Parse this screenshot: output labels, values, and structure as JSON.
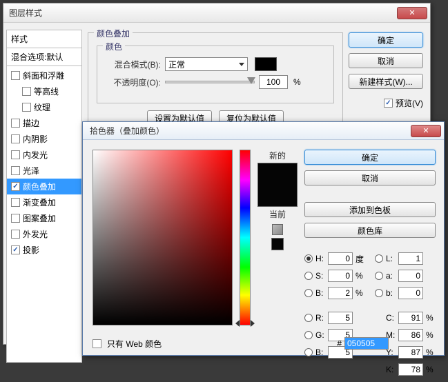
{
  "main": {
    "title": "图层样式",
    "styles_header": "样式",
    "styles_sub": "混合选项:默认",
    "items": [
      {
        "label": "斜面和浮雕",
        "checked": false,
        "indent": false
      },
      {
        "label": "等高线",
        "checked": false,
        "indent": true
      },
      {
        "label": "纹理",
        "checked": false,
        "indent": true
      },
      {
        "label": "描边",
        "checked": false,
        "indent": false
      },
      {
        "label": "内阴影",
        "checked": false,
        "indent": false
      },
      {
        "label": "内发光",
        "checked": false,
        "indent": false
      },
      {
        "label": "光泽",
        "checked": false,
        "indent": false
      },
      {
        "label": "颜色叠加",
        "checked": true,
        "indent": false,
        "selected": true
      },
      {
        "label": "渐变叠加",
        "checked": false,
        "indent": false
      },
      {
        "label": "图案叠加",
        "checked": false,
        "indent": false
      },
      {
        "label": "外发光",
        "checked": false,
        "indent": false
      },
      {
        "label": "投影",
        "checked": true,
        "indent": false
      }
    ],
    "section_title": "颜色叠加",
    "inner_title": "颜色",
    "blend_label": "混合模式(B):",
    "blend_value": "正常",
    "opacity_label": "不透明度(O):",
    "opacity_value": "100",
    "pct": "%",
    "set_default": "设置为默认值",
    "reset_default": "复位为默认值",
    "ok": "确定",
    "cancel": "取消",
    "new_style": "新建样式(W)...",
    "preview": "预览(V)"
  },
  "picker": {
    "title": "拾色器（叠加颜色）",
    "ok": "确定",
    "cancel": "取消",
    "add_swatch": "添加到色板",
    "libraries": "颜色库",
    "new": "新的",
    "current": "当前",
    "web_only": "只有 Web 颜色",
    "hash": "#",
    "hex": "050505",
    "H_label": "H:",
    "H_val": "0",
    "H_unit": "度",
    "S_label": "S:",
    "S_val": "0",
    "S_unit": "%",
    "Bhsb_label": "B:",
    "Bhsb_val": "2",
    "Bhsb_unit": "%",
    "L_label": "L:",
    "L_val": "1",
    "a_label": "a:",
    "a_val": "0",
    "blab_label": "b:",
    "blab_val": "0",
    "R_label": "R:",
    "R_val": "5",
    "G_label": "G:",
    "G_val": "5",
    "Brgb_label": "B:",
    "Brgb_val": "5",
    "C_label": "C:",
    "C_val": "91",
    "C_unit": "%",
    "M_label": "M:",
    "M_val": "86",
    "M_unit": "%",
    "Y_label": "Y:",
    "Y_val": "87",
    "Y_unit": "%",
    "K_label": "K:",
    "K_val": "78",
    "K_unit": "%"
  }
}
